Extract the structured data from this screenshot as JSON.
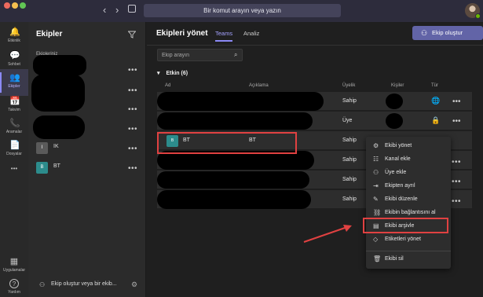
{
  "titlebar": {
    "back": "‹",
    "forward": "›",
    "search_placeholder": "Bir komut arayın veya yazın"
  },
  "rail": [
    {
      "label": "Etkinlik",
      "icon": "bell-icon",
      "glyph": "🔔"
    },
    {
      "label": "Sohbet",
      "icon": "chat-icon",
      "glyph": "💬"
    },
    {
      "label": "Ekipler",
      "icon": "teams-icon",
      "glyph": "👥"
    },
    {
      "label": "Takvim",
      "icon": "calendar-icon",
      "glyph": "📅"
    },
    {
      "label": "Aramalar",
      "icon": "phone-icon",
      "glyph": "📞"
    },
    {
      "label": "Dosyalar",
      "icon": "file-icon",
      "glyph": "📄"
    },
    {
      "label": "",
      "icon": "more-icon",
      "glyph": "•••"
    },
    {
      "label": "Uygulamalar",
      "icon": "apps-icon",
      "glyph": "▦"
    },
    {
      "label": "Yardım",
      "icon": "help-icon",
      "glyph": "?"
    }
  ],
  "panel": {
    "title": "Ekipler",
    "subtitle": "Ekipleriniz",
    "teams": [
      {
        "tile": "I",
        "name": "IK",
        "tile_color": "#5a5a5a"
      },
      {
        "tile": "B",
        "name": "BT",
        "tile_color": "#2c8c8c"
      }
    ],
    "create_link": "Ekip oluştur veya bir ekib..."
  },
  "main": {
    "title": "Ekipleri yönet",
    "tabs": [
      "Teams",
      "Analiz"
    ],
    "create_button": "Ekip oluştur",
    "search_placeholder": "Ekip arayın",
    "section": "Etkin (6)",
    "columns": [
      "Ad",
      "Açıklama",
      "Üyelik",
      "Kişiler",
      "Tür"
    ],
    "rows": [
      {
        "name": "",
        "description": "",
        "membership": "Sahip",
        "type_icon": "globe-icon"
      },
      {
        "name": "",
        "description": "",
        "membership": "Üye",
        "type_icon": "lock-icon"
      },
      {
        "name": "BT",
        "tile": "B",
        "description": "BT",
        "membership": "Sahip",
        "type_icon": ""
      },
      {
        "name": "",
        "description": "",
        "membership": "Sahip",
        "type_icon": ""
      },
      {
        "name": "",
        "description": "",
        "membership": "Sahip",
        "type_icon": ""
      },
      {
        "name": "",
        "description": "",
        "membership": "Sahip",
        "type_icon": ""
      }
    ]
  },
  "menu": [
    {
      "label": "Ekibi yönet",
      "icon": "gear-icon",
      "glyph": "⚙"
    },
    {
      "label": "Kanal ekle",
      "icon": "channel-icon",
      "glyph": "☷"
    },
    {
      "label": "Üye ekle",
      "icon": "add-member-icon",
      "glyph": "⚇"
    },
    {
      "label": "Ekipten ayrıl",
      "icon": "leave-icon",
      "glyph": "⇥"
    },
    {
      "label": "Ekibi düzenle",
      "icon": "edit-icon",
      "glyph": "✎"
    },
    {
      "label": "Ekibin bağlantısını al",
      "icon": "link-icon",
      "glyph": "⛓"
    },
    {
      "label": "Ekibi arşivle",
      "icon": "archive-icon",
      "glyph": "▤"
    },
    {
      "label": "Etiketleri yönet",
      "icon": "tag-icon",
      "glyph": "◇"
    },
    {
      "label": "Ekibi sil",
      "icon": "trash-icon",
      "glyph": "🗑"
    }
  ],
  "colors": {
    "accent": "#6264a7",
    "highlight": "#e04141"
  }
}
